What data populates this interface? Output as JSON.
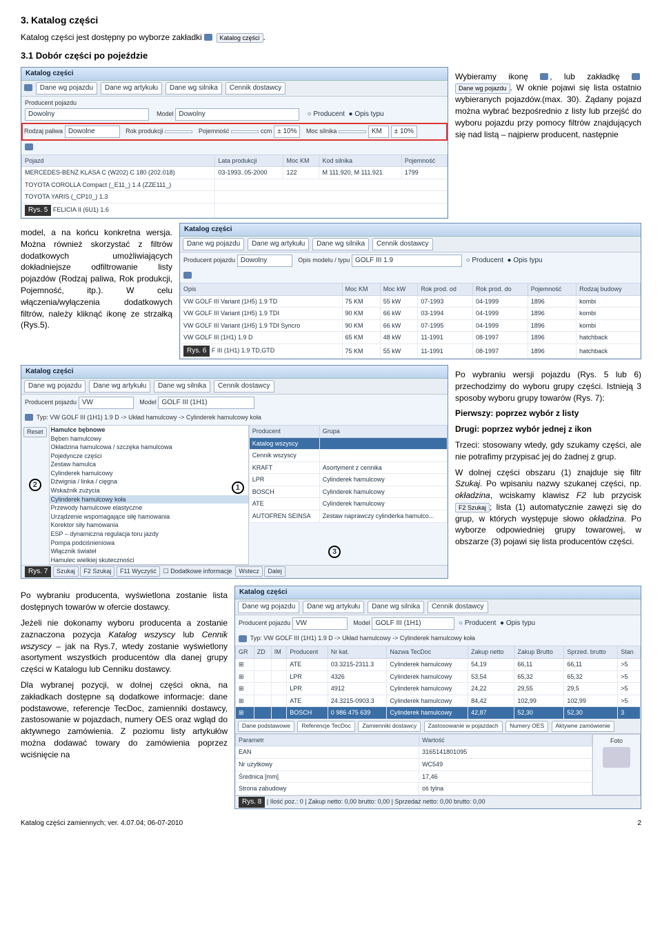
{
  "page": {
    "section_num": "3.",
    "section_title": "Katalog części",
    "intro": "Katalog części jest dostępny po wyborze zakładki",
    "intro_btn": "Katalog części",
    "sub_num": "3.1",
    "sub_title": "Dobór części po pojeździe",
    "footer_left": "Katalog części zamiennych; ver. 4.07.04; 06-07-2010",
    "footer_right": "2"
  },
  "rt1": {
    "p1a": "Wybieramy ikonę",
    "p1b": ", lub zakładkę",
    "btn": "Dane wg pojazdu",
    "p2": ". W oknie pojawi się lista ostatnio wybieranych pojazdów.(max. 30). Żądany pojazd można wybrać bezpośrednio z listy lub przejść do wyboru pojazdu przy pomocy filtrów znajdujących się nad listą – najpierw producent, następnie"
  },
  "lt1": {
    "p": "model, a na końcu konkretna wersja. Można również skorzystać z filtrów dodatkowych umożliwiających dokładniejsze odfiltrowanie listy pojazdów (Rodzaj paliwa, Rok produkcji, Pojemność, itp.). W celu włączenia/wyłączenia dodatkowych filtrów, należy kliknąć ikonę ze strzałką (Rys.5)."
  },
  "rt2": {
    "p1": "Po wybraniu wersji pojazdu (Rys. 5 lub 6) przechodzimy do wyboru grupy części. Istnieją 3 sposoby wyboru grupy towarów (Rys. 7):",
    "p2": "Pierwszy: poprzez wybór z listy",
    "p3": "Drugi: poprzez wybór jednej z ikon",
    "p4": "Trzeci: stosowany wtedy, gdy szukamy części, ale nie potrafimy przypisać jej do żadnej z grup.",
    "p5a": "W dolnej części obszaru (1) znajduje się filtr",
    "p5i": "Szukaj",
    "p5b": ". Po wpisaniu nazwy szukanej części, np.",
    "p5i2": "okładzina",
    "p5c": ", wciskamy klawisz",
    "p5i3": "F2",
    "p5d": " lub przycisk ",
    "btn": "F2 Szukaj",
    "p5e": "; lista (1) automatycznie zawęzi się do grup, w których występuje słowo",
    "p5i4": "okładzina",
    "p5f": ". Po wyborze odpowiedniej grupy towarowej, w obszarze (3) pojawi się lista producentów części."
  },
  "lt2": {
    "p1": "Po wybraniu producenta, wyświetlona zostanie lista dostępnych towarów w ofercie dostawcy.",
    "p2a": "Jeżeli nie dokonamy wyboru producenta a zostanie zaznaczona pozycja",
    "p2i1": "Katalog wszyscy",
    "p2b": " lub ",
    "p2i2": "Cennik wszyscy",
    "p2c": " – jak na Rys.7, wtedy zostanie wyświetlony asortyment wszystkich producentów dla danej grupy części w Katalogu lub Cenniku dostawcy.",
    "p3": "Dla wybranej pozycji, w dolnej części okna, na zakładkach dostępne są dodatkowe informacje: dane podstawowe, referencje TecDoc, zamienniki dostawcy, zastosowanie w pojazdach, numery OES oraz wgląd do aktywnego zamówienia. Z poziomu listy artykułów można dodawać towary do zamówienia poprzez wciśnięcie na"
  },
  "shot5": {
    "title": "Katalog części",
    "tabs": [
      "Dane wg pojazdu",
      "Dane wg artykułu",
      "Dane wg silnika",
      "Cennik dostawcy"
    ],
    "f_prod": "Producent pojazdu",
    "v_prod": "Dowolny",
    "f_model": "Model",
    "v_model": "Dowolny",
    "r_prod": "Producent",
    "r_opis": "Opis typu",
    "f_pal": "Rodzaj paliwa",
    "v_pal": "Dowolne",
    "f_rok": "Rok produkcji",
    "f_poj": "Pojemność",
    "u_poj": "ccm",
    "tol1": "± 10%",
    "f_moc": "Moc silnika",
    "u_moc": "KM",
    "tol2": "± 10%",
    "cols": [
      "Pojazd",
      "Lata produkcji",
      "Moc KM",
      "Kod silnika",
      "Pojemność"
    ],
    "rows": [
      [
        "MERCEDES-BENZ KLASA C (W202) C 180 (202.018)",
        "03-1993..05-2000",
        "122",
        "M 111.920, M 111.921",
        "1799"
      ],
      [
        "TOYOTA COROLLA Compact (_E11_) 1.4 (ZZE111_)",
        "",
        "",
        "",
        ""
      ],
      [
        "TOYOTA YARIS (_CP10_) 1.3",
        "",
        "",
        "",
        ""
      ],
      [
        "FELICIA II (6U1) 1.6",
        "",
        "",
        "",
        ""
      ]
    ],
    "fig": "Rys. 5"
  },
  "shot6": {
    "title": "Katalog części",
    "tabs": [
      "Dane wg pojazdu",
      "Dane wg artykułu",
      "Dane wg silnika",
      "Cennik dostawcy"
    ],
    "f_prod": "Producent pojazdu",
    "v_prod": "Dowolny",
    "f_opis": "Opis modelu / typu",
    "v_opis": "GOLF III 1.9",
    "r_prod": "Producent",
    "r_opis": "Opis typu",
    "cols": [
      "Opis",
      "Moc KM",
      "Moc kW",
      "Rok prod. od",
      "Rok prod. do",
      "Pojemność",
      "Rodzaj budowy"
    ],
    "rows": [
      [
        "VW GOLF III Variant (1H5) 1.9 TD",
        "75 KM",
        "55 kW",
        "07-1993",
        "04-1999",
        "1896",
        "kombi"
      ],
      [
        "VW GOLF III Variant (1H5) 1.9 TDI",
        "90 KM",
        "66 kW",
        "03-1994",
        "04-1999",
        "1896",
        "kombi"
      ],
      [
        "VW GOLF III Variant (1H5) 1.9 TDI Syncro",
        "90 KM",
        "66 kW",
        "07-1995",
        "04-1999",
        "1896",
        "kombi"
      ],
      [
        "VW GOLF III (1H1) 1.9 D",
        "65 KM",
        "48 kW",
        "11-1991",
        "08-1997",
        "1896",
        "hatchback"
      ],
      [
        "F III (1H1) 1.9 TD,GTD",
        "75 KM",
        "55 kW",
        "11-1991",
        "08-1997",
        "1896",
        "hatchback"
      ]
    ],
    "fig": "Rys. 6"
  },
  "shot7": {
    "title": "Katalog części",
    "tabs": [
      "Dane wg pojazdu",
      "Dane wg artykułu",
      "Dane wg silnika",
      "Cennik dostawcy"
    ],
    "f_prod": "Producent pojazdu",
    "v_prod": "VW",
    "f_model": "Model",
    "v_model": "GOLF III (1H1)",
    "crumb": "Typ: VW GOLF III (1H1) 1.9 D -> Układ hamulcowy -> Cylinderek hamulcowy koła",
    "reset": "Reset",
    "tree_head": "Hamulce bębnowe",
    "tree": [
      "Bęben hamulcowy",
      "Okładzina hamulcowa / szczęka hamulcowa",
      "Pojedyncze części",
      "Zestaw hamulca",
      "Cylinderek hamulcowy",
      "Dźwignia / linka / cięgna",
      "Wskaźnik zużycia",
      "Cylinderek hamulcowy koła",
      "Przewody hamulcowe elastyczne",
      "Urządzenie wspomagające siłę hamowania",
      "Korektor siły hamowania",
      "ESP – dynamiczna regulacja toru jazdy",
      "Pompa podciśnieniowa",
      "Włącznik świateł",
      "Hamulec wielkiej skuteczności"
    ],
    "grid_cols": [
      "Producent",
      "Grupa"
    ],
    "grid": [
      [
        "Katalog wszyscy",
        ""
      ],
      [
        "Cennik wszyscy",
        ""
      ],
      [
        "KRAFT",
        "Asortyment z cennika"
      ],
      [
        "LPR",
        "Cylinderek hamulcowy"
      ],
      [
        "BOSCH",
        "Cylinderek hamulcowy"
      ],
      [
        "ATE",
        "Cylinderek hamulcowy"
      ],
      [
        "AUTOFREN SEINSA",
        "Zestaw naprawczy cylinderka hamulco..."
      ]
    ],
    "btns": [
      "Szukaj",
      "F2 Szukaj",
      "F11 Wyczyść",
      "Dodatkowe informacje",
      "Wstecz",
      "Dalej"
    ],
    "fig": "Rys. 7",
    "c1": "1",
    "c2": "2",
    "c3": "3"
  },
  "shot8": {
    "title": "Katalog części",
    "tabs": [
      "Dane wg pojazdu",
      "Dane wg artykułu",
      "Dane wg silnika",
      "Cennik dostawcy"
    ],
    "f_prod": "Producent pojazdu",
    "v_prod": "VW",
    "f_model": "Model",
    "v_model": "GOLF III (1H1)",
    "r_prod": "Producent",
    "r_opis": "Opis typu",
    "crumb": "Typ: VW GOLF III (1H1) 1.9 D -> Układ hamulcowy -> Cylinderek hamulcowy koła",
    "cols": [
      "GR",
      "ZD",
      "IM",
      "Producent",
      "Nr kat.",
      "Nazwa TecDoc",
      "Zakup netto",
      "Zakup Brutto",
      "Sprzed. brutto",
      "Stan"
    ],
    "rows": [
      [
        "",
        "",
        "",
        "ATE",
        "03.3215-2311.3",
        "Cylinderek hamulcowy",
        "54,19",
        "66,11",
        "66,11",
        ">5"
      ],
      [
        "",
        "",
        "",
        "LPR",
        "4326",
        "Cylinderek hamulcowy",
        "53,54",
        "65,32",
        "65,32",
        ">5"
      ],
      [
        "",
        "",
        "",
        "LPR",
        "4912",
        "Cylinderek hamulcowy",
        "24,22",
        "29,55",
        "29,5",
        ">5"
      ],
      [
        "",
        "",
        "",
        "ATE",
        "24.3215-0903.3",
        "Cylinderek hamulcowy",
        "84,42",
        "102,99",
        "102,99",
        ">5"
      ],
      [
        "",
        "",
        "",
        "BOSCH",
        "0 986 475 639",
        "Cylinderek hamulcowy",
        "42,87",
        "52,30",
        "52,30",
        "3"
      ]
    ],
    "detail_tabs": [
      "Dane podstawowe",
      "Referencje TecDoc",
      "Zamienniki dostawcy",
      "Zastosowanie w pojazdach",
      "Numery OES",
      "Aktywne zamówienie"
    ],
    "param_cols": [
      "Parametr",
      "Wartość"
    ],
    "params": [
      [
        "EAN",
        "3165141801095"
      ],
      [
        "Nr użytkowy",
        "WC549"
      ],
      [
        "Średnica [mm]",
        "17,46"
      ],
      [
        "Strona zabudowy",
        "oś tylna"
      ]
    ],
    "foto": "Foto",
    "status": "| Ilość poz.: 0 | Zakup netto: 0,00 brutto: 0,00 | Sprzedaż netto: 0,00 brutto: 0,00",
    "fig": "Rys. 8"
  }
}
